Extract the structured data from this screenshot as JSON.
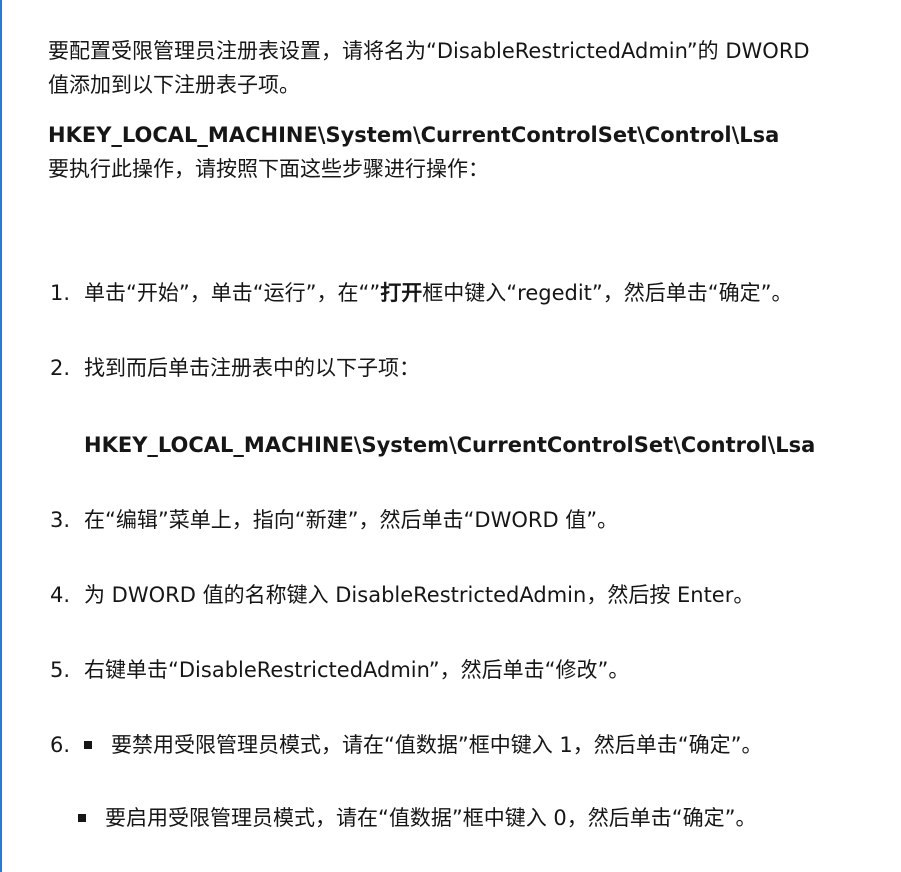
{
  "intro": {
    "line1": "要配置受限管理员注册表设置，请将名为“DisableRestrictedAdmin”的 DWORD",
    "line2": "值添加到以下注册表子项。"
  },
  "registry_key": "HKEY_LOCAL_MACHINE\\System\\CurrentControlSet\\Control\\Lsa",
  "instruction": "要执行此操作，请按照下面这些步骤进行操作：",
  "steps": [
    {
      "num": "1.",
      "pre": "单击“开始”，单击“运行”，在“”",
      "bold": "打开",
      "post": "框中键入“regedit”，然后单击“确定”。"
    },
    {
      "num": "2.",
      "text": "找到而后单击注册表中的以下子项：",
      "subkey": "HKEY_LOCAL_MACHINE\\System\\CurrentControlSet\\Control\\Lsa"
    },
    {
      "num": "3.",
      "text": "在“编辑”菜单上，指向“新建”，然后单击“DWORD 值”。"
    },
    {
      "num": "4.",
      "text": "为 DWORD 值的名称键入 DisableRestrictedAdmin，然后按 Enter。"
    },
    {
      "num": "5.",
      "text": "右键单击“DisableRestrictedAdmin”，然后单击“修改”。"
    },
    {
      "num": "6.",
      "bullet1": "要禁用受限管理员模式，请在“值数据”框中键入 1，然后单击“确定”。",
      "bullet2": "要启用受限管理员模式，请在“值数据”框中键入 0，然后单击“确定”。"
    }
  ],
  "colors": {
    "text": "#161616",
    "accent_rule": "#2b7bd1"
  }
}
